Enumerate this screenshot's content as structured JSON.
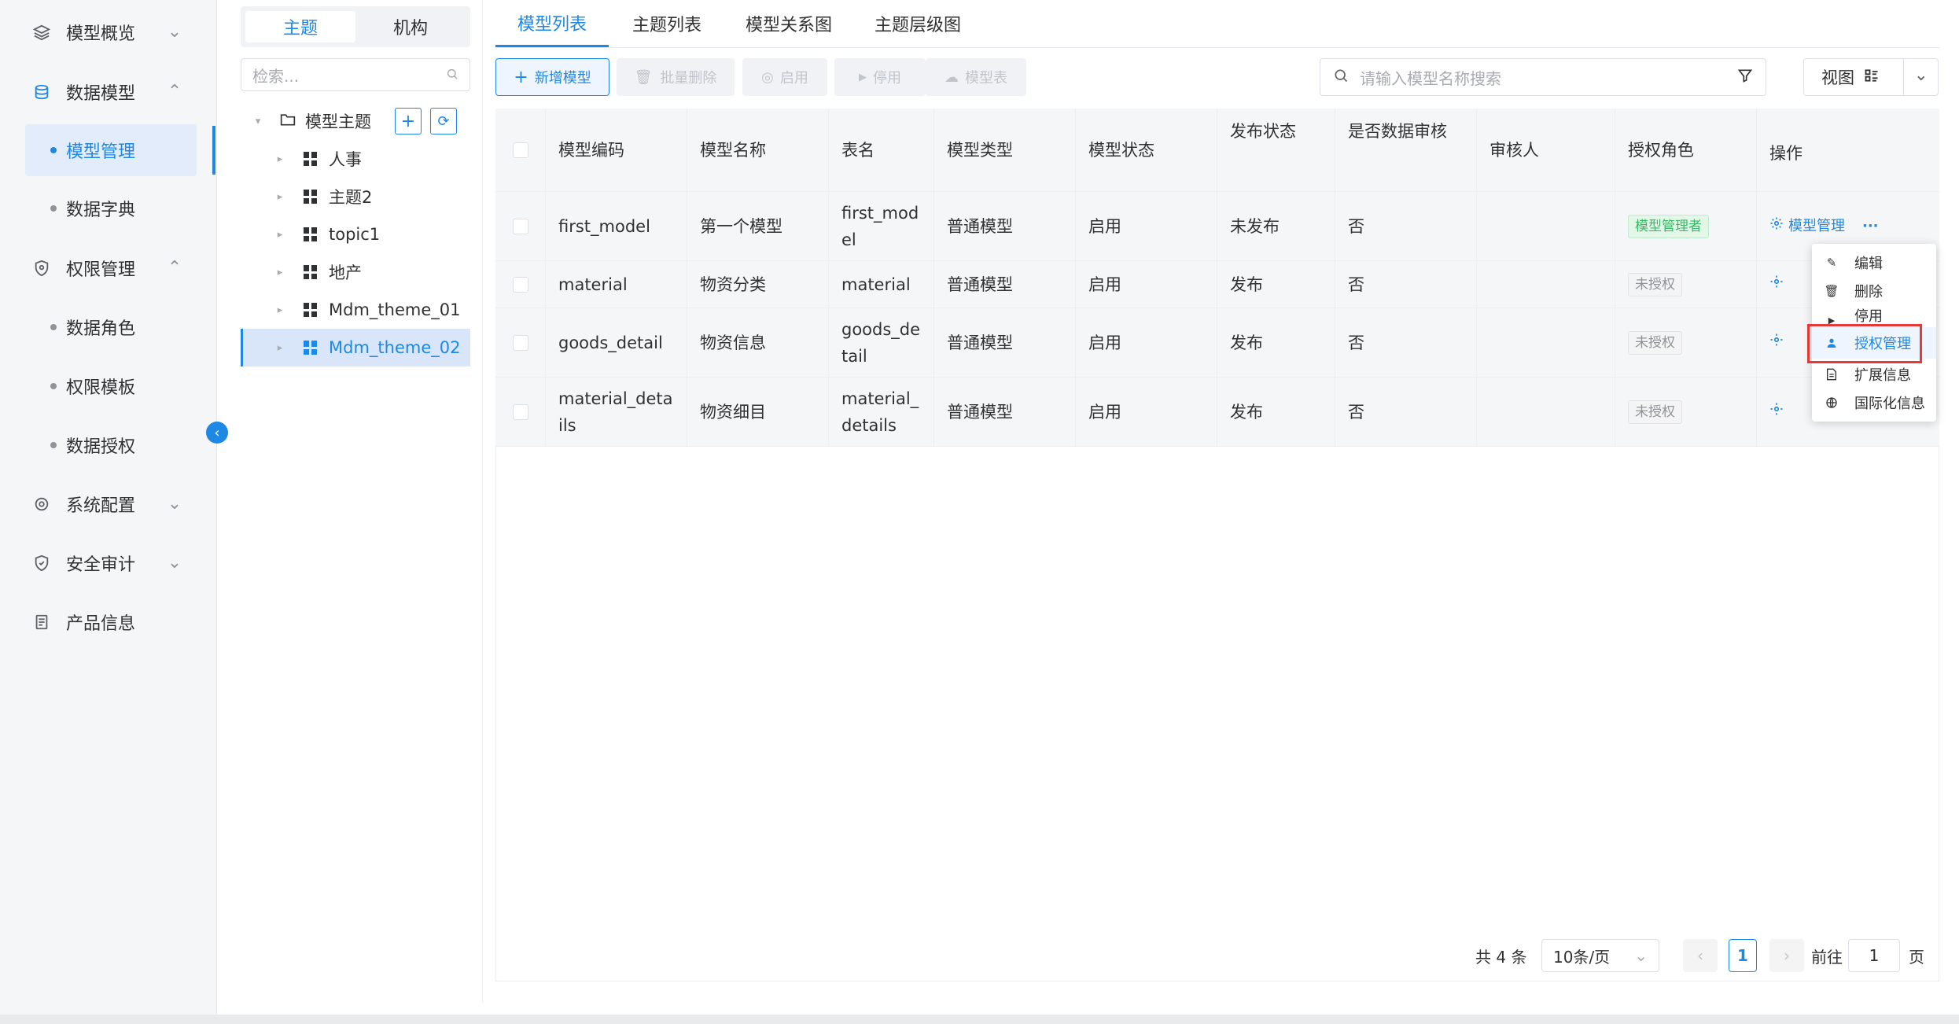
{
  "sidebar": {
    "items": [
      {
        "label": "模型概览",
        "icon": "layers-icon",
        "expanded": false
      },
      {
        "label": "数据模型",
        "icon": "database-icon",
        "expanded": true
      },
      {
        "label": "权限管理",
        "icon": "shield-icon",
        "expanded": true
      },
      {
        "label": "系统配置",
        "icon": "settings-icon",
        "expanded": false
      },
      {
        "label": "安全审计",
        "icon": "audit-icon",
        "expanded": false
      },
      {
        "label": "产品信息",
        "icon": "document-icon",
        "expanded": false
      }
    ],
    "sub_data_model": [
      "模型管理",
      "数据字典"
    ],
    "sub_permission": [
      "数据角色",
      "权限模板",
      "数据授权"
    ]
  },
  "tree": {
    "segments": [
      "主题",
      "机构"
    ],
    "search_placeholder": "检索...",
    "root": "模型主题",
    "nodes": [
      "人事",
      "主题2",
      "topic1",
      "地产",
      "Mdm_theme_01",
      "Mdm_theme_02"
    ],
    "selected": "Mdm_theme_02"
  },
  "tabs": [
    "模型列表",
    "主题列表",
    "模型关系图",
    "主题层级图"
  ],
  "toolbar": {
    "add": "新增模型",
    "batch_delete": "批量删除",
    "enable": "启用",
    "disable": "停用",
    "model_table": "模型表",
    "search_placeholder": "请输入模型名称搜索",
    "view": "视图"
  },
  "table": {
    "headers": [
      "模型编码",
      "模型名称",
      "表名",
      "模型类型",
      "模型状态",
      "发布状态",
      "是否数据审核",
      "审核人",
      "授权角色",
      "操作"
    ],
    "rows": [
      {
        "code": "first_model",
        "name": "第一个模型",
        "table": "first_model",
        "type": "普通模型",
        "status": "启用",
        "publish": "未发布",
        "audit": "否",
        "auditor": "",
        "role": "模型管理者"
      },
      {
        "code": "material",
        "name": "物资分类",
        "table": "material",
        "type": "普通模型",
        "status": "启用",
        "publish": "发布",
        "audit": "否",
        "auditor": "",
        "role": "未授权"
      },
      {
        "code": "goods_detail",
        "name": "物资信息",
        "table": "goods_detail",
        "type": "普通模型",
        "status": "启用",
        "publish": "发布",
        "audit": "否",
        "auditor": "",
        "role": "未授权"
      },
      {
        "code": "material_details",
        "name": "物资细目",
        "table": "material_details",
        "type": "普通模型",
        "status": "启用",
        "publish": "发布",
        "audit": "否",
        "auditor": "",
        "role": "未授权"
      }
    ],
    "op_label": "模型管理",
    "more": "···"
  },
  "dropdown": {
    "items": [
      "编辑",
      "删除",
      "停用",
      "授权管理",
      "扩展信息",
      "国际化信息"
    ],
    "highlighted": "授权管理"
  },
  "pager": {
    "total": "共 4 条",
    "page_size": "10条/页",
    "current": "1",
    "goto_label": "前往",
    "goto_value": "1",
    "page_unit": "页"
  },
  "colors": {
    "accent": "#1e88e5",
    "highlight_box": "#e53935",
    "tag_green": "#38b965"
  }
}
